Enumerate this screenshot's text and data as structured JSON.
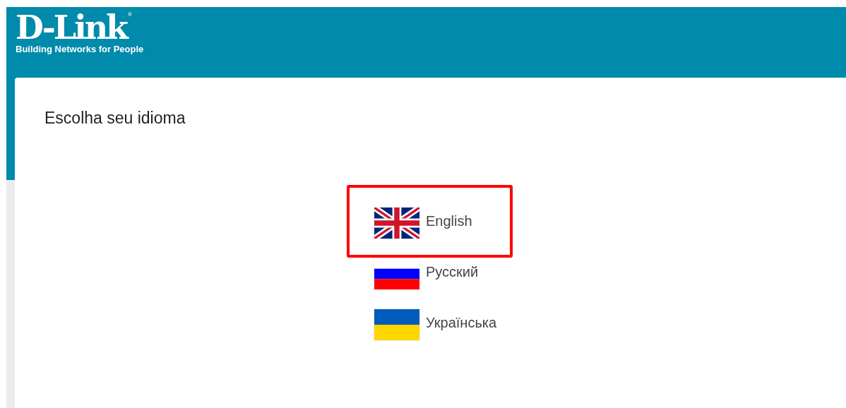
{
  "header": {
    "logo": "D-Link",
    "registered_mark": "®",
    "tagline": "Building Networks for People"
  },
  "card": {
    "title": "Escolha seu idioma"
  },
  "languages": [
    {
      "label": "English",
      "kind": "uk",
      "highlighted": true
    },
    {
      "label": "Русский",
      "kind": "ru",
      "highlighted": false
    },
    {
      "label": "Українська",
      "kind": "ua",
      "highlighted": false
    }
  ]
}
